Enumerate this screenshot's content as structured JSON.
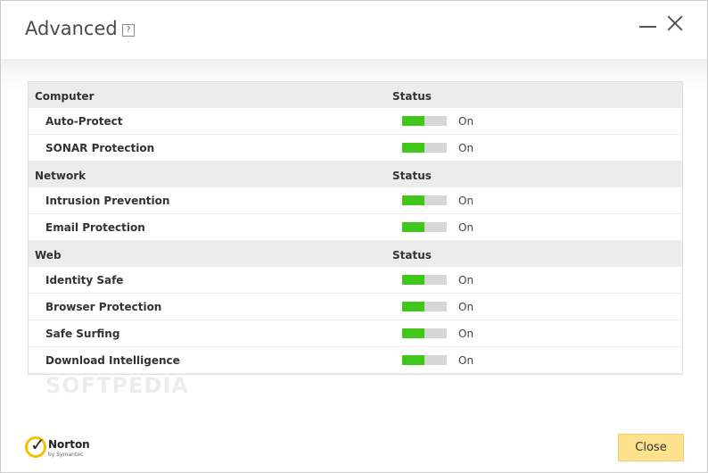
{
  "window": {
    "title": "Advanced",
    "help_label": "?"
  },
  "groups": [
    {
      "name": "Computer",
      "status_header": "Status",
      "items": [
        {
          "label": "Auto-Protect",
          "state": "On",
          "level": 0.5
        },
        {
          "label": "SONAR Protection",
          "state": "On",
          "level": 0.5
        }
      ]
    },
    {
      "name": "Network",
      "status_header": "Status",
      "items": [
        {
          "label": "Intrusion Prevention",
          "state": "On",
          "level": 0.5
        },
        {
          "label": "Email Protection",
          "state": "On",
          "level": 0.5
        }
      ]
    },
    {
      "name": "Web",
      "status_header": "Status",
      "items": [
        {
          "label": "Identity Safe",
          "state": "On",
          "level": 0.5
        },
        {
          "label": "Browser Protection",
          "state": "On",
          "level": 0.5
        },
        {
          "label": "Safe Surfing",
          "state": "On",
          "level": 0.5
        },
        {
          "label": "Download Intelligence",
          "state": "On",
          "level": 0.5
        }
      ]
    }
  ],
  "watermark": "SOFTPEDIA",
  "logo": {
    "name": "Norton",
    "sub": "by Symantec"
  },
  "footer": {
    "close_label": "Close"
  },
  "colors": {
    "accent_green": "#3fc71a",
    "button_yellow": "#fde18c",
    "bar_track": "#d6d6d6"
  }
}
